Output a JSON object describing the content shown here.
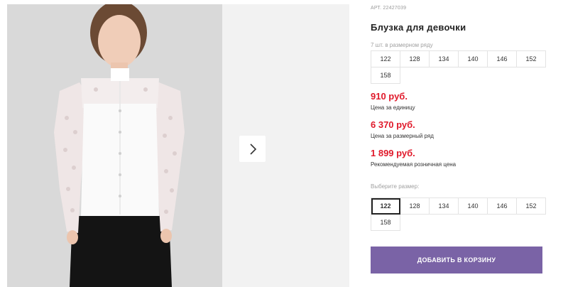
{
  "product": {
    "article": "АРТ. 22427039",
    "title": "Блузка для девочки"
  },
  "pack": {
    "label": "7 шт. в размерном ряду",
    "sizes": [
      "122",
      "128",
      "134",
      "140",
      "146",
      "152",
      "158"
    ]
  },
  "prices": {
    "unit_price": "910 руб.",
    "unit_note": "Цена за единицу",
    "pack_price": "6 370 руб.",
    "pack_note": "Цена за размерный ряд",
    "retail_price": "1 899 руб.",
    "retail_note": "Рекомендуемая розничная цена"
  },
  "size_select": {
    "label": "Выберите размер:",
    "options": [
      "122",
      "128",
      "134",
      "140",
      "146",
      "152",
      "158"
    ],
    "selected": "122"
  },
  "cart": {
    "button_label": "ДОБАВИТЬ В КОРЗИНУ"
  },
  "colors": {
    "price_red": "#e01a2b",
    "cart_purple": "#7a63a6"
  },
  "icons": {
    "next": "chevron-right-icon"
  }
}
